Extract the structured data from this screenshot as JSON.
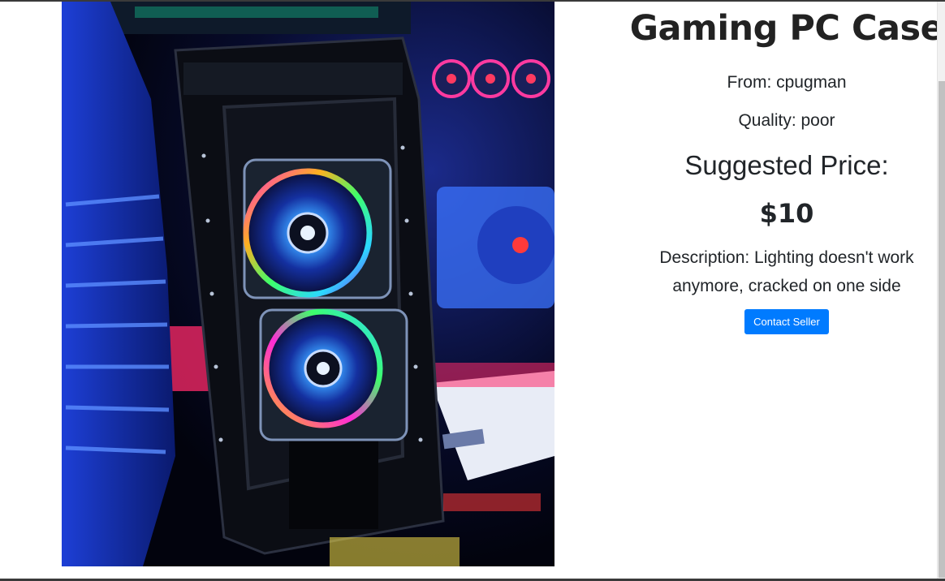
{
  "product": {
    "title": "Gaming PC Case",
    "seller": "From: cpugman",
    "quality": "Quality: poor",
    "price_label": "Suggested Price:",
    "price": "$10",
    "description": "Description: Lighting doesn't work anymore, cracked on one side",
    "contact_button": "Contact Seller",
    "photo_caption": "Gaming PC case with RGB fans"
  },
  "colors": {
    "accent": "#007bff",
    "text": "#212529"
  }
}
